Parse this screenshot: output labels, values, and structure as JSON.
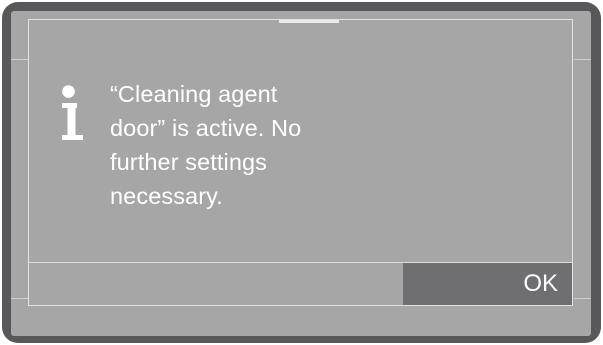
{
  "dialog": {
    "message_lines": [
      "“Cleaning agent",
      "door” is active. No",
      "further settings",
      "necessary."
    ],
    "ok_label": "OK",
    "icon": "info-icon"
  },
  "colors": {
    "bezel": "#58585b",
    "screen": "#a6a6a7",
    "button": "#6f6f72",
    "text": "#ffffff"
  }
}
